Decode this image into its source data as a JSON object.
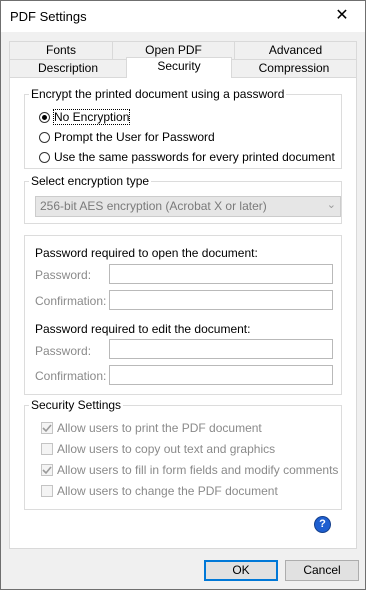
{
  "window": {
    "title": "PDF Settings",
    "close_glyph": "✕"
  },
  "tabs": {
    "row1": [
      "Fonts",
      "Open PDF",
      "Advanced"
    ],
    "row2": [
      "Description",
      "Security",
      "Compression"
    ],
    "active": "Security"
  },
  "encrypt_group": {
    "legend": "Encrypt the printed document using a password",
    "options": [
      {
        "label": "No Encryption",
        "selected": true
      },
      {
        "label": "Prompt the User for Password",
        "selected": false
      },
      {
        "label": "Use the same passwords for every printed document",
        "selected": false
      }
    ]
  },
  "encryption_type": {
    "legend": "Select encryption type",
    "selected": "256-bit AES encryption (Acrobat X or later)"
  },
  "passwords": {
    "open_heading": "Password required to open the document:",
    "edit_heading": "Password required to edit the document:",
    "password_label": "Password:",
    "confirmation_label": "Confirmation:"
  },
  "security_settings": {
    "legend": "Security Settings",
    "items": [
      {
        "label": "Allow users to print the PDF document",
        "checked": true
      },
      {
        "label": "Allow users to copy out text and graphics",
        "checked": false
      },
      {
        "label": "Allow users to fill in form fields and modify comments",
        "checked": true
      },
      {
        "label": "Allow users to change the PDF document",
        "checked": false
      }
    ]
  },
  "buttons": {
    "ok": "OK",
    "cancel": "Cancel"
  },
  "icons": {
    "help": "?"
  },
  "colors": {
    "accent": "#0078d7",
    "help": "#1e5fd0"
  }
}
